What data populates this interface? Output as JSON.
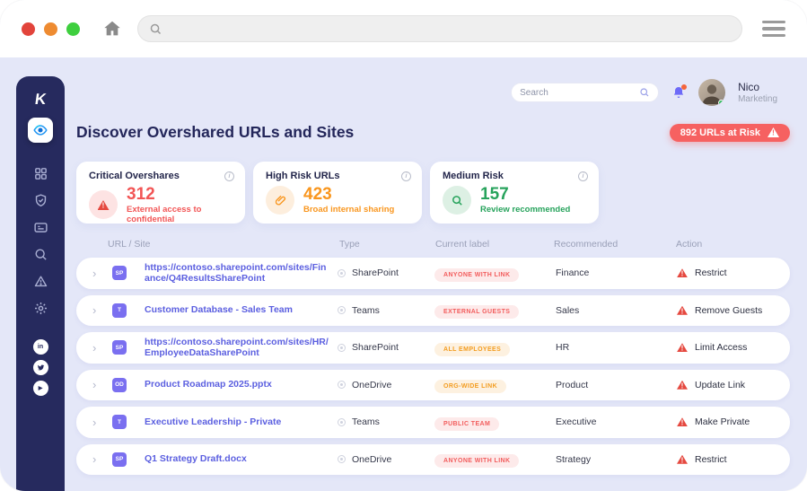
{
  "chrome": {
    "traffic_lights": [
      "#e2443b",
      "#ee8b31",
      "#3ecf3e"
    ],
    "address_bar": {
      "value": ""
    }
  },
  "sidebar": {
    "logo_text": "K",
    "active_item": "discover-eye",
    "nav_icons": [
      "grid",
      "shield-check",
      "id-card",
      "search",
      "alert-triangle",
      "gear"
    ],
    "social_icons": [
      "linkedin",
      "twitter",
      "youtube"
    ]
  },
  "topbar": {
    "search_placeholder": "Search",
    "user": {
      "name": "Nico",
      "role": "Marketing"
    }
  },
  "page": {
    "title": "Discover Overshared URLs and Sites",
    "risk_badge": "892 URLs at Risk"
  },
  "stats": [
    {
      "label": "Critical Overshares",
      "value": "312",
      "subtitle": "External access to confidential",
      "tone": "red",
      "icon": "warning-triangle",
      "color": "#f25555"
    },
    {
      "label": "High Risk URLs",
      "value": "423",
      "subtitle": "Broad internal sharing",
      "tone": "orange",
      "icon": "paperclip",
      "color": "#f9961e"
    },
    {
      "label": "Medium Risk",
      "value": "157",
      "subtitle": "Review recommended",
      "tone": "green",
      "icon": "magnifier",
      "color": "#27a35c"
    }
  ],
  "table": {
    "columns": [
      "URL / Site",
      "Type",
      "Current label",
      "Recommended",
      "Action"
    ],
    "rows": [
      {
        "source": "SP",
        "title": "https://contoso.sharepoint.com/sites/Finance/Q4ResultsSharePoint",
        "type": "SharePoint",
        "current_label": "ANYONE WITH LINK",
        "label_tone": "red",
        "recommended": "Finance",
        "action": "Restrict"
      },
      {
        "source": "T",
        "title": "Customer Database - Sales Team",
        "type": "Teams",
        "current_label": "EXTERNAL GUESTS",
        "label_tone": "red",
        "recommended": "Sales",
        "action": "Remove Guests"
      },
      {
        "source": "SP",
        "title": "https://contoso.sharepoint.com/sites/HR/EmployeeDataSharePoint",
        "type": "SharePoint",
        "current_label": "ALL EMPLOYEES",
        "label_tone": "orange",
        "recommended": "HR",
        "action": "Limit Access"
      },
      {
        "source": "OD",
        "title": "Product Roadmap 2025.pptx",
        "type": "OneDrive",
        "current_label": "ORG-WIDE LINK",
        "label_tone": "orange",
        "recommended": "Product",
        "action": "Update Link"
      },
      {
        "source": "T",
        "title": "Executive Leadership - Private",
        "type": "Teams",
        "current_label": "PUBLIC TEAM",
        "label_tone": "red",
        "recommended": "Executive",
        "action": "Make Private"
      },
      {
        "source": "SP",
        "title": "Q1 Strategy Draft.docx",
        "type": "OneDrive",
        "current_label": "ANYONE WITH LINK",
        "label_tone": "red",
        "recommended": "Strategy",
        "action": "Restrict"
      }
    ]
  },
  "colors": {
    "sidebar_navy": "#262a5e",
    "page_bg": "#e4e7f8",
    "link_indigo": "#5b5fe0",
    "risk_red": "#f66161",
    "warn_orange": "#f9961e",
    "ok_green": "#27a35c"
  }
}
